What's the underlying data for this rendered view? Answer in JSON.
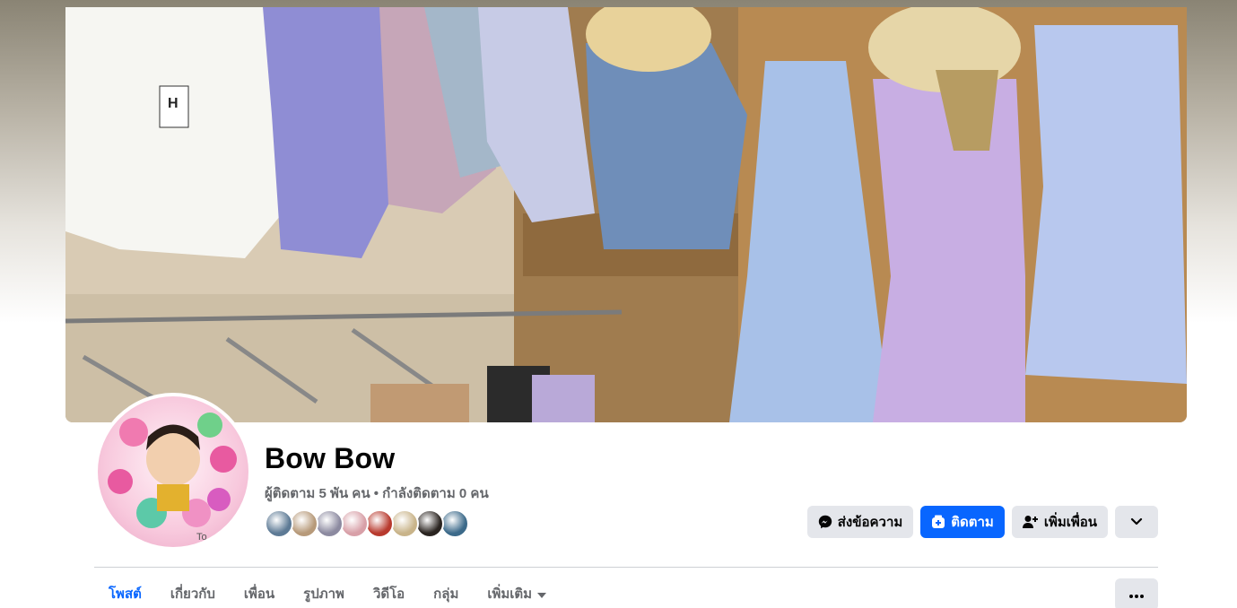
{
  "profile": {
    "name": "Bow Bow",
    "stats": "ผู้ติดตาม 5 พัน คน • กำลังติดตาม 0 คน",
    "avatar_text": "To"
  },
  "cover": {
    "tag_letter": "H"
  },
  "friends": {
    "avatar_colors": [
      "#5d7a95",
      "#b79a7a",
      "#8c8aa0",
      "#d8a0a8",
      "#b83a2e",
      "#c9b48a",
      "#2a2420",
      "#3c6a8a"
    ]
  },
  "actions": {
    "message_label": "ส่งข้อความ",
    "follow_label": "ติดตาม",
    "add_friend_label": "เพิ่มเพื่อน"
  },
  "tabs": [
    {
      "label": "โพสต์",
      "active": true
    },
    {
      "label": "เกี่ยวกับ",
      "active": false
    },
    {
      "label": "เพื่อน",
      "active": false
    },
    {
      "label": "รูปภาพ",
      "active": false
    },
    {
      "label": "วิดีโอ",
      "active": false
    },
    {
      "label": "กลุ่ม",
      "active": false
    },
    {
      "label": "เพิ่มเติม",
      "active": false
    }
  ],
  "colors": {
    "accent": "#0866ff",
    "secondary_button": "#e4e6eb",
    "muted_text": "#65676b"
  }
}
